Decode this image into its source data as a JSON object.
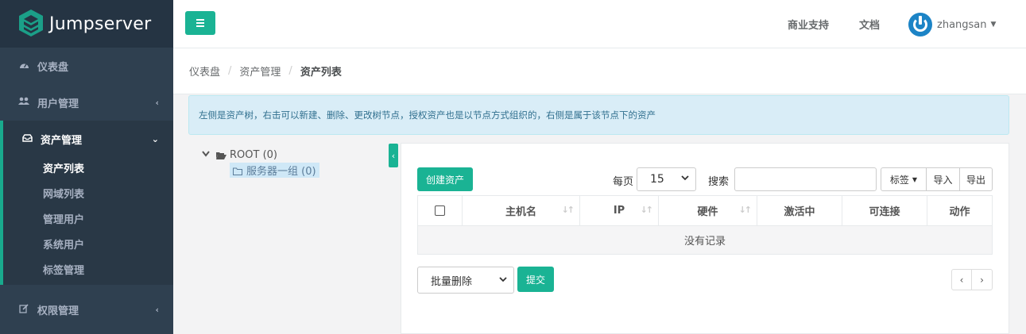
{
  "brand": {
    "name": "Jumpserver"
  },
  "sidebar": {
    "items": [
      {
        "label": "仪表盘",
        "icon": "dashboard-icon"
      },
      {
        "label": "用户管理",
        "icon": "users-icon"
      },
      {
        "label": "资产管理",
        "icon": "inbox-icon"
      },
      {
        "label": "权限管理",
        "icon": "edit-icon"
      }
    ],
    "submenu": [
      {
        "label": "资产列表"
      },
      {
        "label": "网域列表"
      },
      {
        "label": "管理用户"
      },
      {
        "label": "系统用户"
      },
      {
        "label": "标签管理"
      }
    ]
  },
  "topbar": {
    "support": "商业支持",
    "docs": "文档",
    "username": "zhangsan"
  },
  "breadcrumb": [
    "仪表盘",
    "资产管理",
    "资产列表"
  ],
  "alert": {
    "text": "左侧是资产树，右击可以新建、删除、更改树节点，授权资产也是以节点方式组织的，右侧是属于该节点下的资产"
  },
  "tree": {
    "root": "ROOT (0)",
    "child": "服务器一组 (0)"
  },
  "toolbar": {
    "create_label": "创建资产",
    "per_page_label": "每页",
    "per_page_value": "15",
    "search_label": "搜索",
    "search_value": "",
    "tags_label": "标签",
    "import_label": "导入",
    "export_label": "导出"
  },
  "table": {
    "columns": [
      "主机名",
      "IP",
      "硬件",
      "激活中",
      "可连接",
      "动作"
    ],
    "empty_text": "没有记录"
  },
  "bulk": {
    "action_value": "批量删除",
    "submit_label": "提交"
  },
  "pagination": {
    "prev": "‹",
    "next": "›"
  },
  "colors": {
    "primary": "#1ab394",
    "sidebar": "#2f4050",
    "alert_bg": "#d9edf7"
  }
}
